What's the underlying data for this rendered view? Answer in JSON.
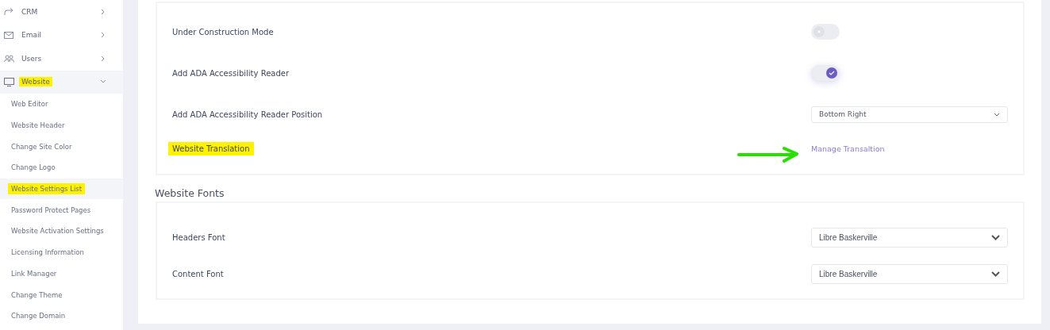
{
  "sidebar": {
    "items": [
      {
        "label": "CRM",
        "expanded": false,
        "highlighted": false
      },
      {
        "label": "Email",
        "expanded": false,
        "highlighted": false
      },
      {
        "label": "Users",
        "expanded": false,
        "highlighted": false
      },
      {
        "label": "Website",
        "expanded": true,
        "highlighted": true,
        "children": [
          {
            "label": "Web Editor",
            "selected": false,
            "highlighted": false
          },
          {
            "label": "Website Header",
            "selected": false,
            "highlighted": false
          },
          {
            "label": "Change Site Color",
            "selected": false,
            "highlighted": false
          },
          {
            "label": "Change Logo",
            "selected": false,
            "highlighted": false
          },
          {
            "label": "Website Settings List",
            "selected": true,
            "highlighted": true
          },
          {
            "label": "Password Protect Pages",
            "selected": false,
            "highlighted": false
          },
          {
            "label": "Website Activation Settings",
            "selected": false,
            "highlighted": false
          },
          {
            "label": "Licensing Information",
            "selected": false,
            "highlighted": false
          },
          {
            "label": "Link Manager",
            "selected": false,
            "highlighted": false
          },
          {
            "label": "Change Theme",
            "selected": false,
            "highlighted": false
          },
          {
            "label": "Change Domain",
            "selected": false,
            "highlighted": false
          }
        ]
      }
    ]
  },
  "settings": {
    "rows": [
      {
        "kind": "toggle",
        "label": "Under Construction Mode",
        "on": false,
        "highlighted": false
      },
      {
        "kind": "toggle",
        "label": "Add ADA Accessibility Reader",
        "on": true,
        "highlighted": false
      },
      {
        "kind": "select",
        "label": "Add ADA Accessibility Reader Position",
        "value": "Bottom Right",
        "highlighted": false
      },
      {
        "kind": "link",
        "label": "Website Translation",
        "link": "Manage Transaltion",
        "highlighted": true
      }
    ]
  },
  "fonts": {
    "title": "Website Fonts",
    "rows": [
      {
        "kind": "native-select",
        "label": "Headers Font",
        "value": "Libre Baskerville",
        "highlighted": false
      },
      {
        "kind": "native-select",
        "label": "Content Font",
        "value": "Libre Baskerville",
        "highlighted": false
      }
    ]
  }
}
